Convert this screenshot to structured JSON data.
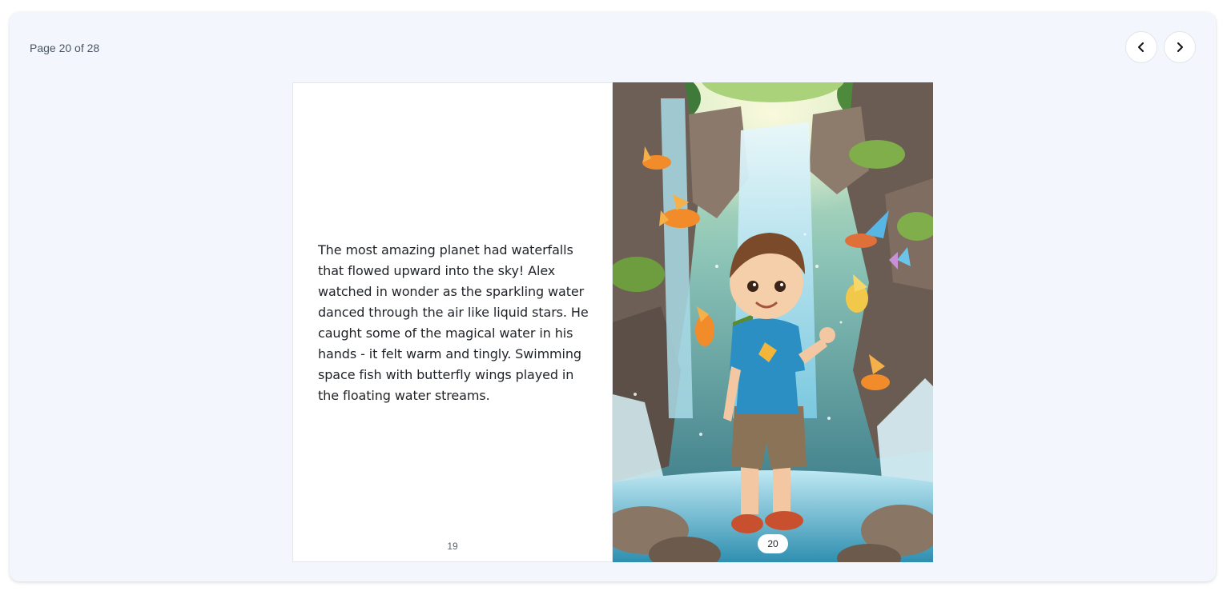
{
  "header": {
    "page_indicator": "Page 20 of 28",
    "prev_icon": "chevron-left-icon",
    "next_icon": "chevron-right-icon"
  },
  "book": {
    "left_page": {
      "text": "The most amazing planet had waterfalls that flowed upward into the sky! Alex watched in wonder as the sparkling water danced through the air like liquid stars. He caught some of the magical water in his hands - it felt warm and tingly. Swimming space fish with butterfly wings played in the floating water streams.",
      "page_number": "19"
    },
    "right_page": {
      "page_number": "20"
    }
  },
  "colors": {
    "viewer_bg": "#f3f7fd",
    "text": "#1f2328",
    "water": "#6fc3dd",
    "rock": "#8a7a6a",
    "shirt": "#2b8fc4",
    "fish": "#f28c2a"
  }
}
